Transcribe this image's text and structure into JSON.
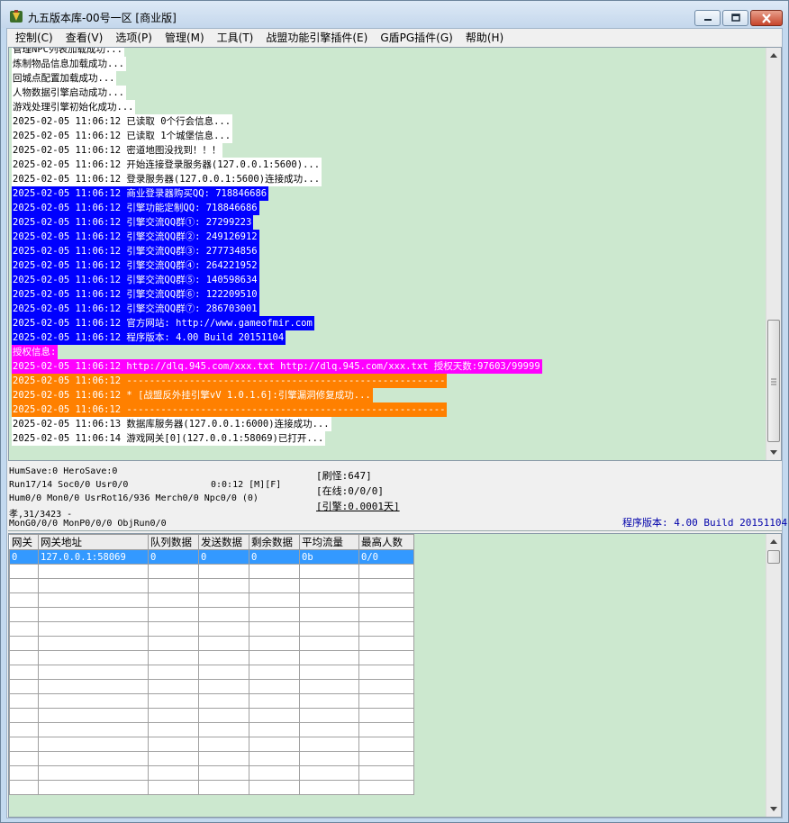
{
  "window": {
    "title": "九五版本库-00号一区 [商业版]"
  },
  "menu": [
    "控制(C)",
    "查看(V)",
    "选项(P)",
    "管理(M)",
    "工具(T)",
    "战盟功能引擎插件(E)",
    "G盾PG插件(G)",
    "帮助(H)"
  ],
  "log": [
    {
      "text": "管理NPC列表加载成功...",
      "style": "white"
    },
    {
      "text": "炼制物品信息加载成功...",
      "style": "white"
    },
    {
      "text": "回城点配置加载成功...",
      "style": "white"
    },
    {
      "text": "人物数据引擎启动成功...",
      "style": "white"
    },
    {
      "text": "游戏处理引擎初始化成功...",
      "style": "white"
    },
    {
      "text": "2025-02-05 11:06:12 已读取 0个行会信息...",
      "style": "white"
    },
    {
      "text": "2025-02-05 11:06:12 已读取 1个城堡信息...",
      "style": "white"
    },
    {
      "text": "2025-02-05 11:06:12 密道地图没找到！！！",
      "style": "white"
    },
    {
      "text": "2025-02-05 11:06:12 开始连接登录服务器(127.0.0.1:5600)...",
      "style": "white"
    },
    {
      "text": "2025-02-05 11:06:12 登录服务器(127.0.0.1:5600)连接成功...",
      "style": "white"
    },
    {
      "text": "2025-02-05 11:06:12 商业登录器购买QQ: 718846686",
      "style": "blue"
    },
    {
      "text": "2025-02-05 11:06:12 引擎功能定制QQ: 718846686",
      "style": "blue"
    },
    {
      "text": "2025-02-05 11:06:12 引擎交流QQ群①: 27299223",
      "style": "blue"
    },
    {
      "text": "2025-02-05 11:06:12 引擎交流QQ群②: 249126912",
      "style": "blue"
    },
    {
      "text": "2025-02-05 11:06:12 引擎交流QQ群③: 277734856",
      "style": "blue"
    },
    {
      "text": "2025-02-05 11:06:12 引擎交流QQ群④: 264221952",
      "style": "blue"
    },
    {
      "text": "2025-02-05 11:06:12 引擎交流QQ群⑤: 140598634",
      "style": "blue"
    },
    {
      "text": "2025-02-05 11:06:12 引擎交流QQ群⑥: 122209510",
      "style": "blue"
    },
    {
      "text": "2025-02-05 11:06:12 引擎交流QQ群⑦: 286703001",
      "style": "blue"
    },
    {
      "text": "2025-02-05 11:06:12 官方网站: http://www.gameofmir.com",
      "style": "blue"
    },
    {
      "text": "2025-02-05 11:06:12 程序版本: 4.00 Build 20151104",
      "style": "blue"
    },
    {
      "text": "授权信息:",
      "style": "magenta"
    },
    {
      "text": "2025-02-05 11:06:12 http://dlq.945.com/xxx.txt http://dlq.945.com/xxx.txt 授权天数:97603/99999",
      "style": "magenta"
    },
    {
      "text": "2025-02-05 11:06:12 --------------------------------------------------------",
      "style": "orange"
    },
    {
      "text": "2025-02-05 11:06:12 * [战盟反外挂引擎vV 1.0.1.6]:引擎漏洞修复成功...",
      "style": "orange"
    },
    {
      "text": "2025-02-05 11:06:12 --------------------------------------------------------",
      "style": "orange"
    },
    {
      "text": "2025-02-05 11:06:13 数据库服务器(127.0.0.1:6000)连接成功...",
      "style": "white"
    },
    {
      "text": "2025-02-05 11:06:14 游戏网关[0](127.0.0.1:58069)已打开...",
      "style": "white"
    }
  ],
  "status": {
    "line1": "HumSave:0 HeroSave:0",
    "line2": "Run17/14 Soc0/0 Usr0/0",
    "timer": "0:0:12 [M][F]",
    "line3": "Hum0/0 Mon0/0 UsrRot16/936 Merch0/0 Npc0/0 (0)",
    "line4": "孝,31/3423 -",
    "line5": "MonG0/0/0 MonP0/0/0 ObjRun0/0",
    "refresh": "[刷怪:647]",
    "online": "[在线:0/0/0]",
    "engine": "[引擎:0.0001天]",
    "version": "程序版本: 4.00 Build 20151104"
  },
  "grid": {
    "headers": [
      "网关",
      "网关地址",
      "队列数据",
      "发送数据",
      "剩余数据",
      "平均流量",
      "最高人数"
    ],
    "rows": [
      [
        "0",
        "127.0.0.1:58069",
        "0",
        "0",
        "0",
        "0b",
        "0/0"
      ]
    ]
  },
  "colors": {
    "log_background": "#cce8cf",
    "highlight_blue": "#0000ff",
    "highlight_magenta": "#ff00ff",
    "highlight_orange": "#ff8000",
    "selection": "#3399ff"
  }
}
